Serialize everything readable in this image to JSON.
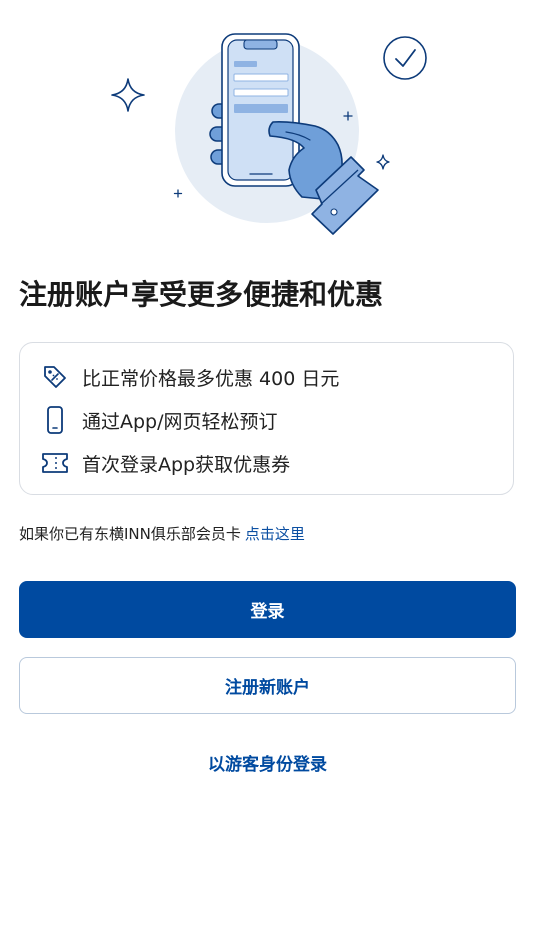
{
  "headline": "注册账户享受更多便捷和优惠",
  "benefits": [
    {
      "icon": "price-tag-icon",
      "text": "比正常价格最多优惠 400 日元"
    },
    {
      "icon": "smartphone-icon",
      "text": "通过App/网页轻松预订"
    },
    {
      "icon": "coupon-ticket-icon",
      "text": "首次登录App获取优惠券"
    }
  ],
  "member_note": {
    "text": "如果你已有东横INN俱乐部会员卡",
    "link": "点击这里"
  },
  "buttons": {
    "login": "登录",
    "register": "注册新账户",
    "guest_login": "以游客身份登录"
  },
  "colors": {
    "primary": "#004aa0",
    "link": "#0b4fa2",
    "illustration_circle": "#e6edf5",
    "border": "#d9dde3"
  },
  "illustration": {
    "icons": [
      "hand-holding-phone-icon",
      "check-circle-icon",
      "sparkle-icon"
    ]
  }
}
